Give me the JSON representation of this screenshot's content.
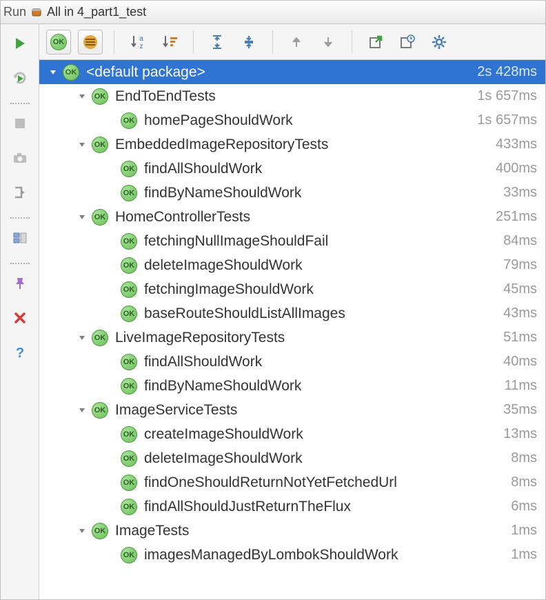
{
  "titlebar": {
    "runLabel": "Run",
    "title": "All in 4_part1_test"
  },
  "sidebar": {
    "run": "run-icon",
    "debug": "debug-icon",
    "stop": "stop-icon",
    "dump": "camera-icon",
    "exit": "exit-icon",
    "layout": "layout-icon",
    "pin": "pin-icon",
    "close": "close-icon",
    "help": "help-icon"
  },
  "toolbar": {
    "ok": "ok-icon",
    "hidePassed": "hide-passed-icon",
    "sort": "sort-az-icon",
    "sortTime": "sort-time-icon",
    "expand": "expand-icon",
    "collapse": "collapse-icon",
    "prev": "prev-icon",
    "next": "next-icon",
    "export": "export-icon",
    "history": "history-icon",
    "settings": "settings-icon"
  },
  "badge": {
    "ok": "OK"
  },
  "tree": [
    {
      "name": "<default package>",
      "time": "2s 428ms",
      "depth": 0,
      "expanded": true,
      "selected": true,
      "status": "ok",
      "children": [
        {
          "name": "EndToEndTests",
          "time": "1s 657ms",
          "depth": 1,
          "expanded": true,
          "status": "ok",
          "children": [
            {
              "name": "homePageShouldWork",
              "time": "1s 657ms",
              "depth": 2,
              "status": "ok"
            }
          ]
        },
        {
          "name": "EmbeddedImageRepositoryTests",
          "time": "433ms",
          "depth": 1,
          "expanded": true,
          "status": "ok",
          "children": [
            {
              "name": "findAllShouldWork",
              "time": "400ms",
              "depth": 2,
              "status": "ok"
            },
            {
              "name": "findByNameShouldWork",
              "time": "33ms",
              "depth": 2,
              "status": "ok"
            }
          ]
        },
        {
          "name": "HomeControllerTests",
          "time": "251ms",
          "depth": 1,
          "expanded": true,
          "status": "ok",
          "children": [
            {
              "name": "fetchingNullImageShouldFail",
              "time": "84ms",
              "depth": 2,
              "status": "ok"
            },
            {
              "name": "deleteImageShouldWork",
              "time": "79ms",
              "depth": 2,
              "status": "ok"
            },
            {
              "name": "fetchingImageShouldWork",
              "time": "45ms",
              "depth": 2,
              "status": "ok"
            },
            {
              "name": "baseRouteShouldListAllImages",
              "time": "43ms",
              "depth": 2,
              "status": "ok"
            }
          ]
        },
        {
          "name": "LiveImageRepositoryTests",
          "time": "51ms",
          "depth": 1,
          "expanded": true,
          "status": "ok",
          "children": [
            {
              "name": "findAllShouldWork",
              "time": "40ms",
              "depth": 2,
              "status": "ok"
            },
            {
              "name": "findByNameShouldWork",
              "time": "11ms",
              "depth": 2,
              "status": "ok"
            }
          ]
        },
        {
          "name": "ImageServiceTests",
          "time": "35ms",
          "depth": 1,
          "expanded": true,
          "status": "ok",
          "children": [
            {
              "name": "createImageShouldWork",
              "time": "13ms",
              "depth": 2,
              "status": "ok"
            },
            {
              "name": "deleteImageShouldWork",
              "time": "8ms",
              "depth": 2,
              "status": "ok"
            },
            {
              "name": "findOneShouldReturnNotYetFetchedUrl",
              "time": "8ms",
              "depth": 2,
              "status": "ok"
            },
            {
              "name": "findAllShouldJustReturnTheFlux",
              "time": "6ms",
              "depth": 2,
              "status": "ok"
            }
          ]
        },
        {
          "name": "ImageTests",
          "time": "1ms",
          "depth": 1,
          "expanded": true,
          "status": "ok",
          "children": [
            {
              "name": "imagesManagedByLombokShouldWork",
              "time": "1ms",
              "depth": 2,
              "status": "ok"
            }
          ]
        }
      ]
    }
  ]
}
